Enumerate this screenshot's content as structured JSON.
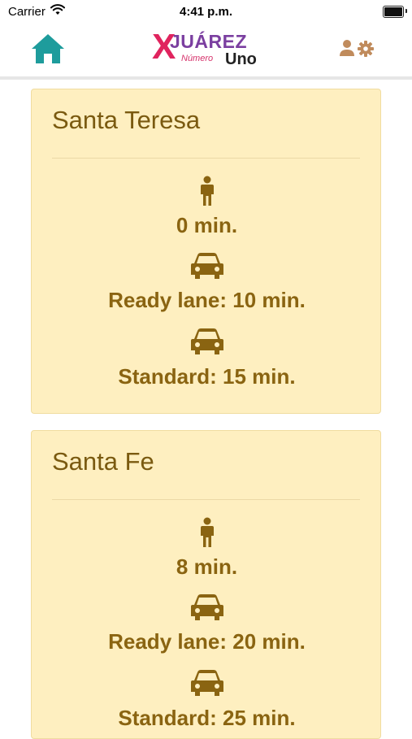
{
  "status_bar": {
    "carrier": "Carrier",
    "time": "4:41 p.m."
  },
  "nav": {
    "logo": {
      "x": "X",
      "juarez": "JUÁREZ",
      "numero": "Número",
      "uno": "Uno"
    }
  },
  "colors": {
    "accent_teal": "#1e9c9c",
    "card_background": "#feefc0",
    "card_text": "#8a6411",
    "settings_icon": "#c08b5c"
  },
  "icons": [
    "home-icon",
    "user-settings-icon",
    "person-walking-icon",
    "car-icon"
  ],
  "crossings": [
    {
      "name": "Santa Teresa",
      "pedestrian": "0 min.",
      "ready_lane": "Ready lane: 10 min.",
      "standard": "Standard: 15 min."
    },
    {
      "name": "Santa Fe",
      "pedestrian": "8 min.",
      "ready_lane": "Ready lane: 20 min.",
      "standard": "Standard: 25 min."
    }
  ]
}
